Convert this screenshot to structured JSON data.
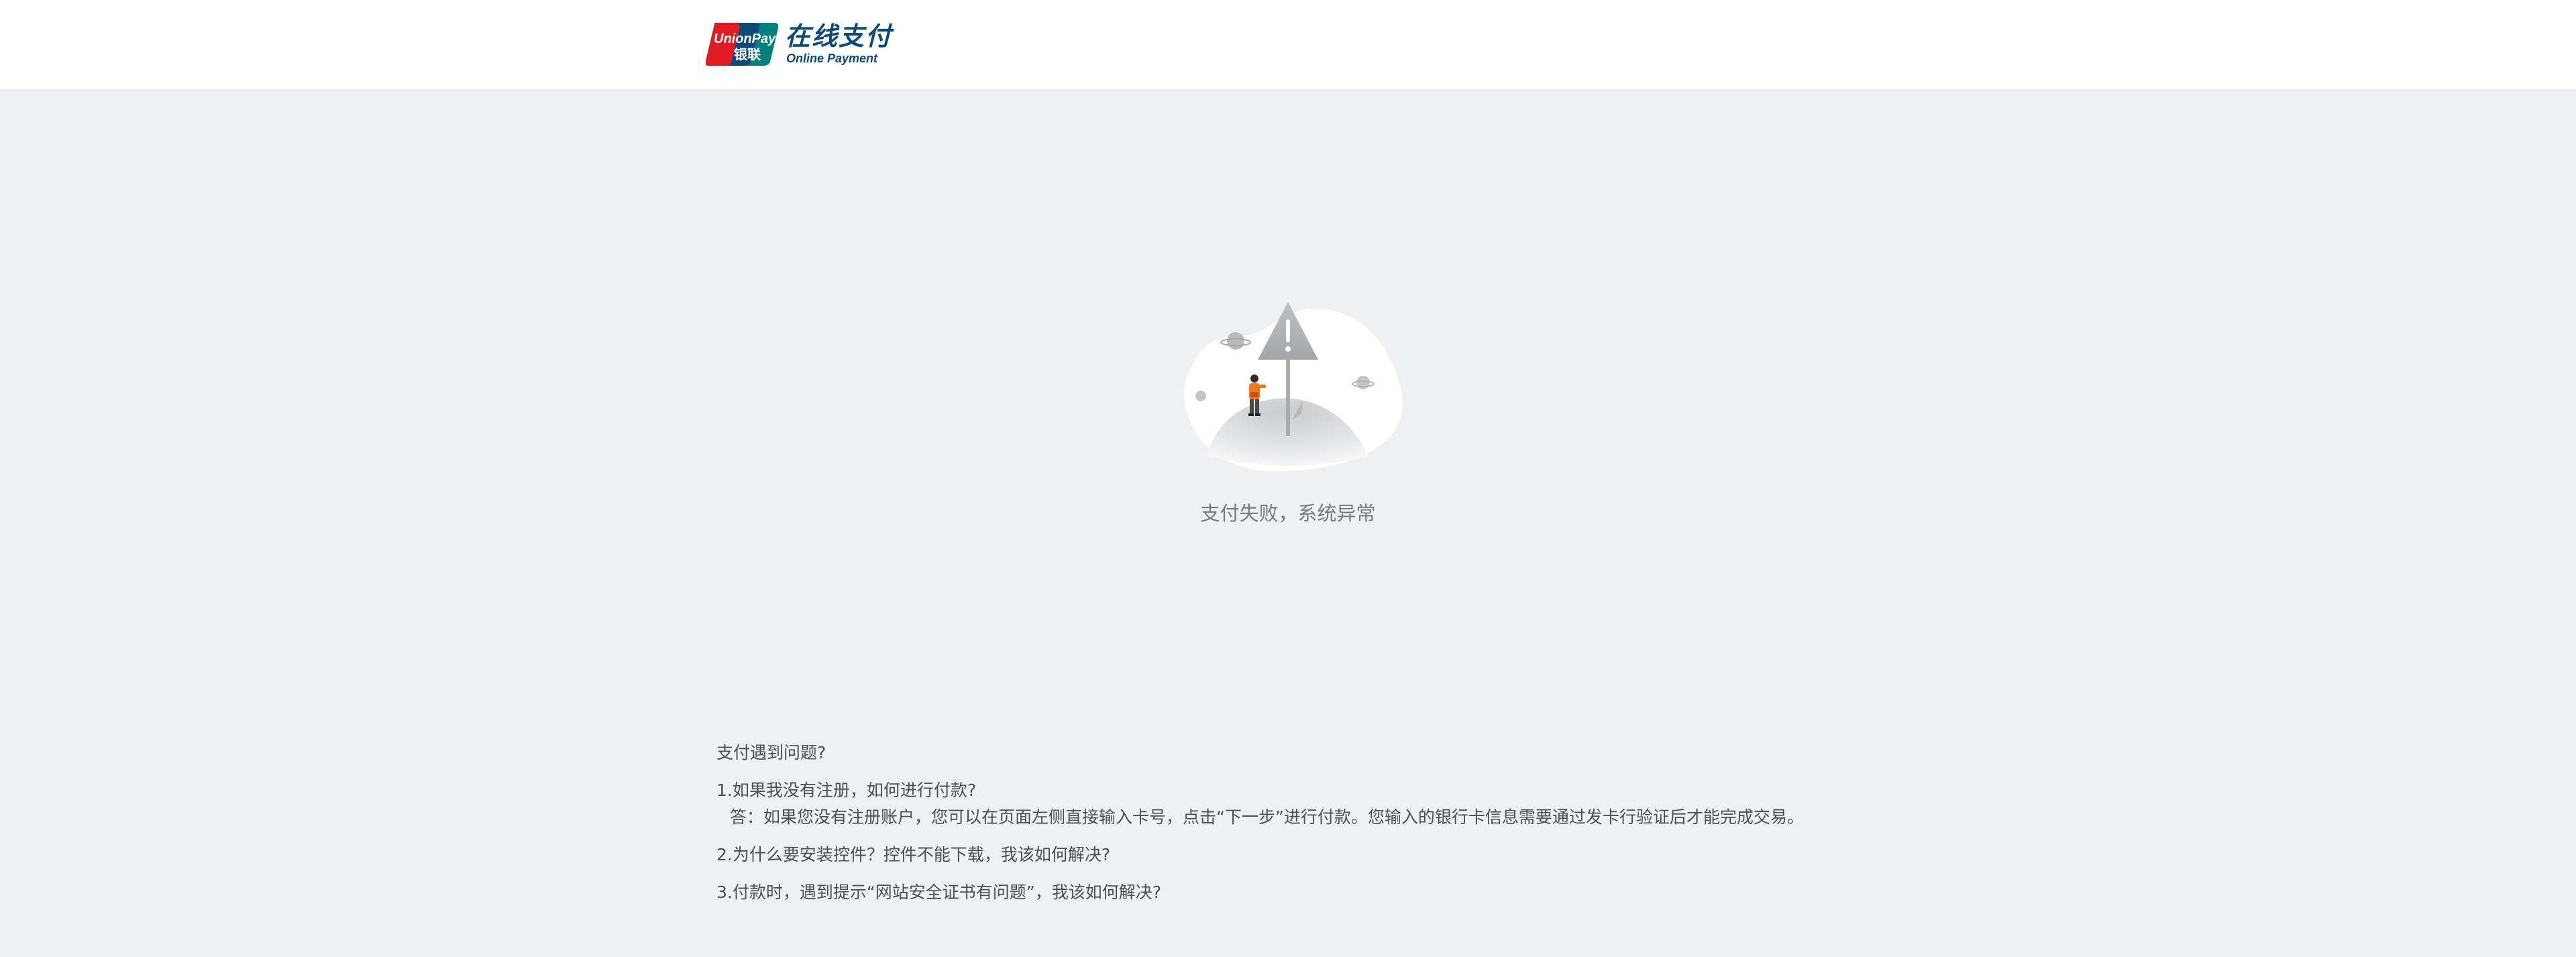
{
  "header": {
    "logo": {
      "card_text_top": "UnionPay",
      "card_text_bottom": "银联",
      "title_cn": "在线支付",
      "title_en": "Online Payment",
      "colors": {
        "red": "#e01b24",
        "blue": "#0c4a7a",
        "teal": "#00807c"
      }
    }
  },
  "main": {
    "illustration_icon": "warning-sign-illustration",
    "status_message": "支付失败，系统异常"
  },
  "faq": {
    "title": "支付遇到问题?",
    "items": [
      {
        "question": "1.如果我没有注册，如何进行付款?",
        "answer": "答：如果您没有注册账户，您可以在页面左侧直接输入卡号，点击“下一步”进行付款。您输入的银行卡信息需要通过发卡行验证后才能完成交易。"
      },
      {
        "question": "2.为什么要安装控件？控件不能下载，我该如何解决?"
      },
      {
        "question": "3.付款时，遇到提示“网站安全证书有问题”，我该如何解决?"
      }
    ]
  }
}
